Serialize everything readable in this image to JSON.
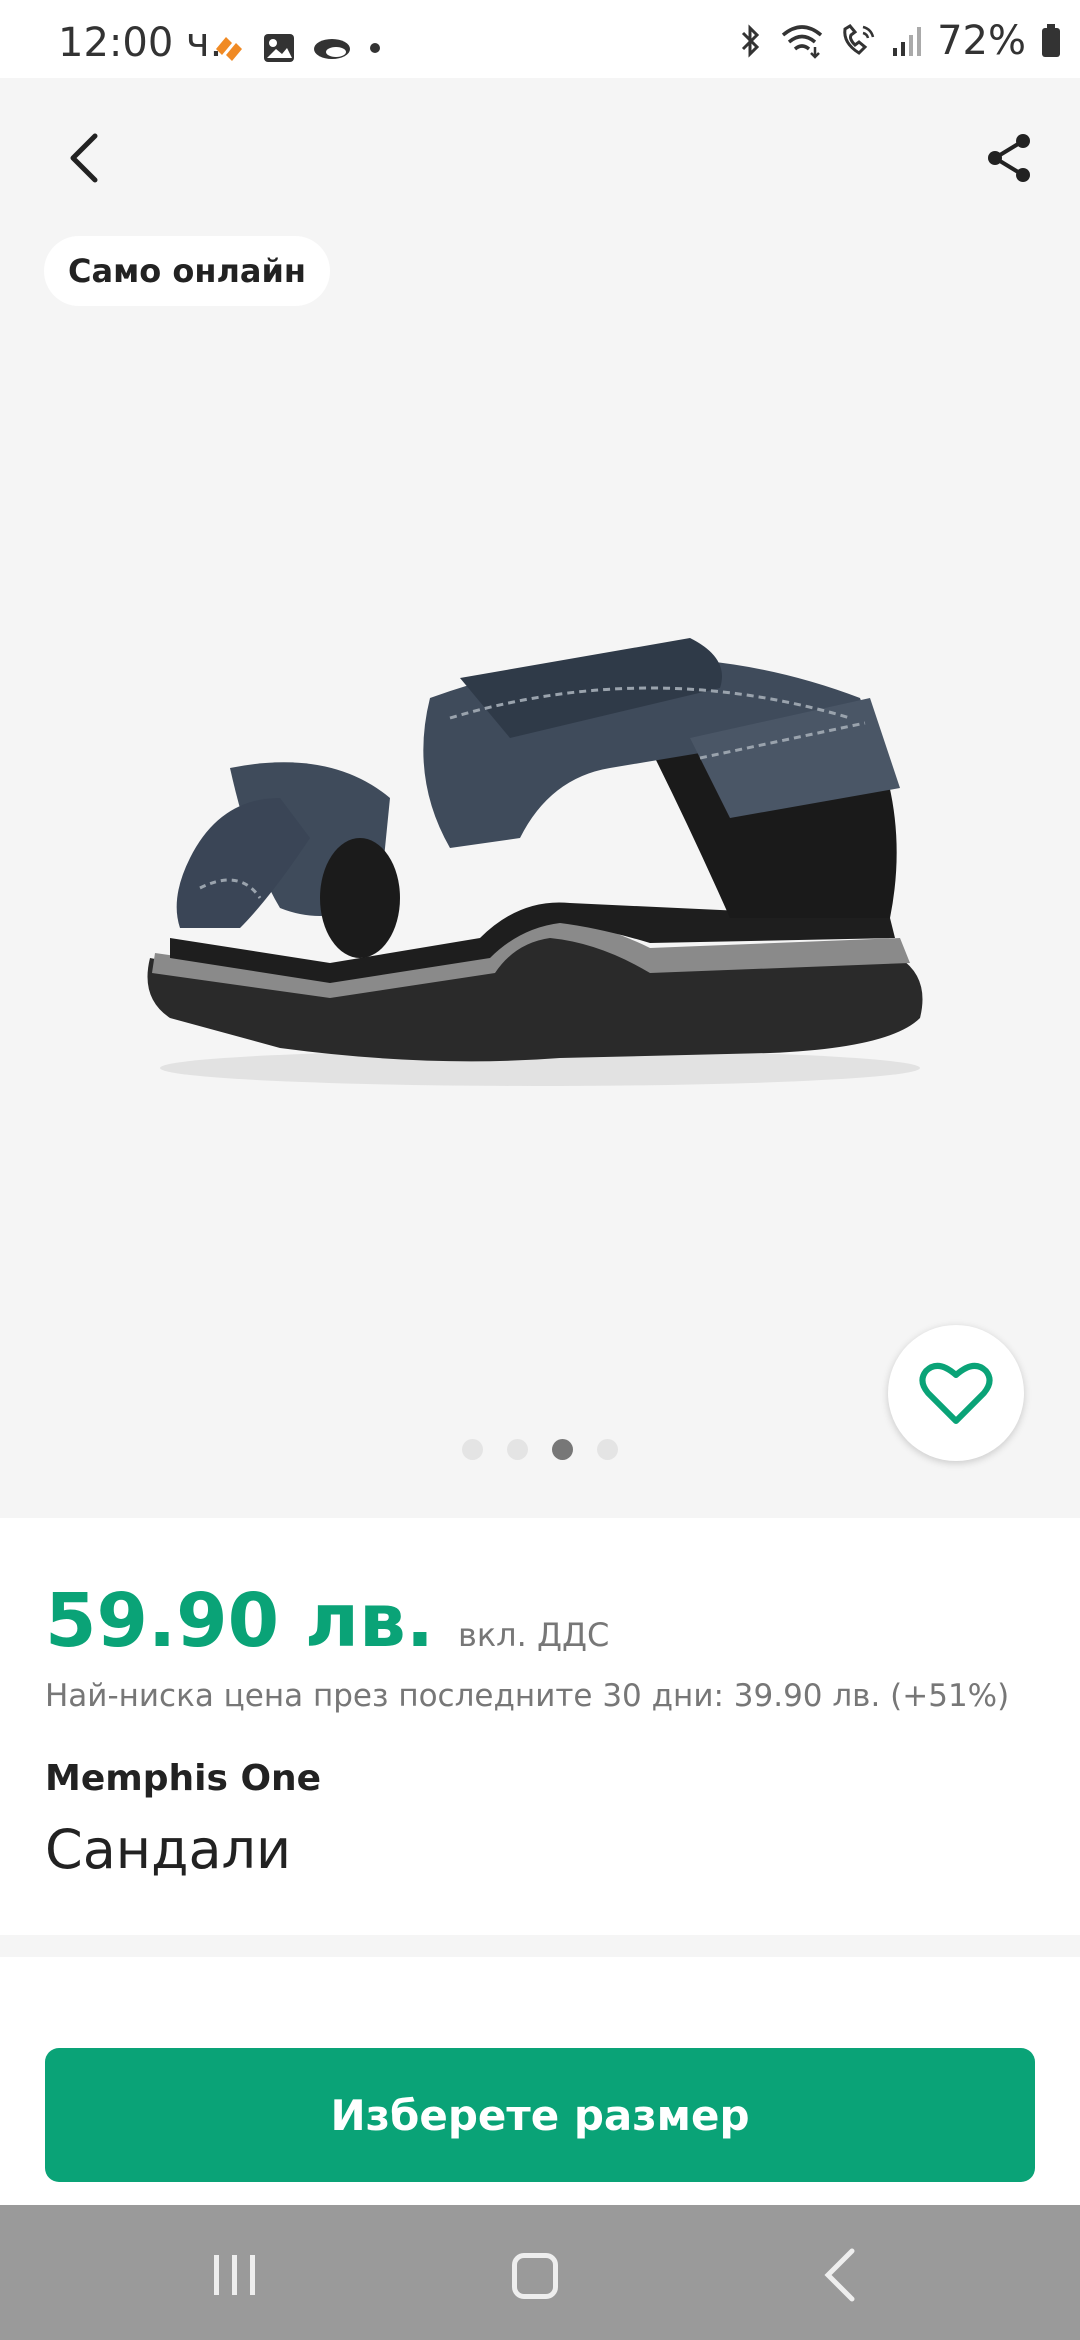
{
  "status_bar": {
    "time": "12:00 ч.",
    "battery_percent": "72%",
    "icons_left": [
      "app-notification-icon",
      "gallery-icon",
      "cloud-icon",
      "dot-icon"
    ],
    "icons_right": [
      "bluetooth-icon",
      "wifi-icon",
      "call-icon",
      "signal-icon",
      "battery-icon"
    ]
  },
  "gallery": {
    "badge": "Само онлайн",
    "dot_count": 4,
    "active_dot": 3
  },
  "product": {
    "price": "59.90 лв.",
    "vat_note": "вкл. ДДС",
    "lowest_price_note": "Най-ниска цена през последните 30 дни: 39.90 лв. (+51%)",
    "brand": "Memphis One",
    "name": "Сандали"
  },
  "cta": {
    "label": "Изберете размер"
  },
  "colors": {
    "accent": "#0aa377",
    "gallery_bg": "#f5f5f5"
  }
}
